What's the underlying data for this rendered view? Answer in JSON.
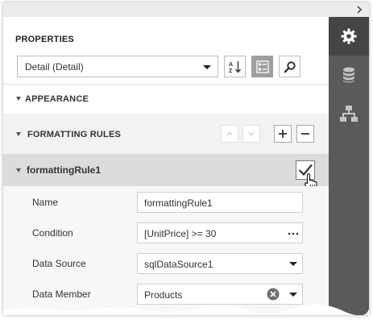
{
  "properties_panel": {
    "title": "PROPERTIES",
    "object_selector": {
      "value": "Detail (Detail)"
    },
    "toolbar": {
      "sort_icon": "sort-alphabetical-icon",
      "categories_icon": "categorized-icon",
      "search_icon": "search-icon"
    }
  },
  "sections": {
    "appearance": {
      "label": "APPEARANCE"
    },
    "formatting_rules": {
      "label": "FORMATTING RULES"
    }
  },
  "rule": {
    "name": "formattingRule1",
    "checked": true,
    "properties": [
      {
        "label": "Name",
        "value": "formattingRule1",
        "editor": "text"
      },
      {
        "label": "Condition",
        "value": "[UnitPrice] >= 30",
        "editor": "ellipsis"
      },
      {
        "label": "Data Source",
        "value": "sqlDataSource1",
        "editor": "dropdown"
      },
      {
        "label": "Data Member",
        "value": "Products",
        "editor": "dropdown-clear"
      }
    ]
  },
  "side_tabs": [
    {
      "name": "properties",
      "icon": "gear-icon",
      "active": true
    },
    {
      "name": "field-list",
      "icon": "database-icon",
      "active": false
    },
    {
      "name": "report-explorer",
      "icon": "hierarchy-icon",
      "active": false
    }
  ],
  "colors": {
    "side_bar": "#5a5a5a",
    "side_tab_active": "#454545",
    "selected_row": "#dcdcdc",
    "band": "#f2f2f2"
  }
}
